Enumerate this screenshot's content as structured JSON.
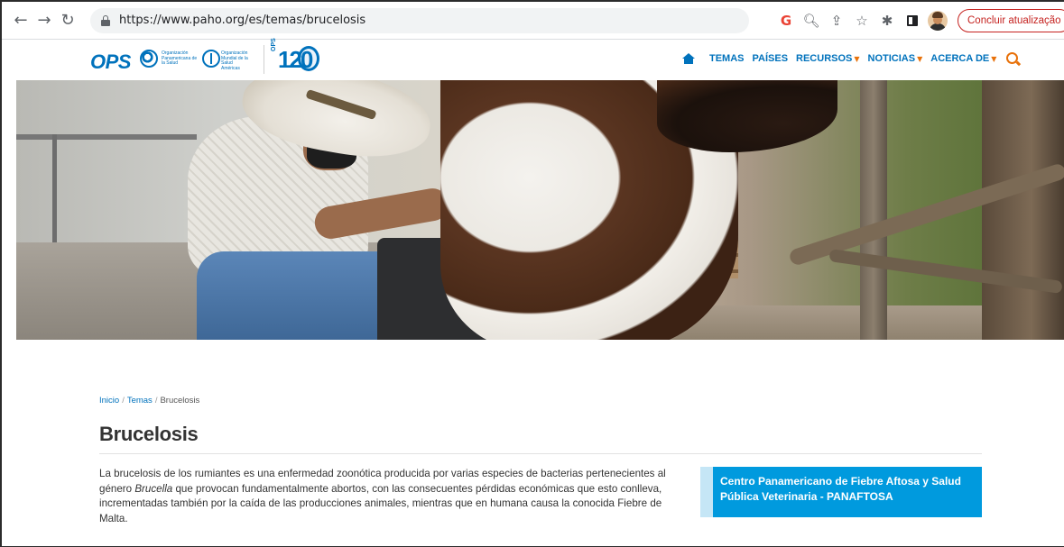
{
  "browser": {
    "url": "https://www.paho.org/es/temas/brucelosis",
    "update_label": "Concluir atualização",
    "icons": [
      "back-arrow-icon",
      "forward-arrow-icon",
      "reload-icon",
      "lock-icon",
      "google-lens-icon",
      "zoom-icon",
      "share-icon",
      "star-icon",
      "extensions-icon",
      "side-panel-icon",
      "profile-avatar",
      "menu-icon"
    ]
  },
  "site": {
    "logo_main": "OPS",
    "logo_ops_text": "Organización Panamericana de la Salud",
    "logo_who_text": "Organización Mundial de la Salud",
    "logo_who_subtext": "Américas",
    "logo_anniversary": "120",
    "logo_anniversary_tag": "OPS",
    "nav": {
      "home_icon": "home-icon",
      "items": [
        "TEMAS",
        "PAÍSES",
        "RECURSOS",
        "NOTICIAS",
        "ACERCA DE"
      ],
      "dropdown_chevron": "⌄",
      "search_icon": "search-icon"
    },
    "brand_color": "#0072bc",
    "accent_color": "#e8710a"
  },
  "breadcrumb": {
    "items": [
      "Inicio",
      "Temas",
      "Brucelosis"
    ],
    "separator": "/"
  },
  "page": {
    "title": "Brucelosis",
    "intro_before": "La brucelosis de los rumiantes es una enfermedad zoonótica producida por varias especies de bacterias pertenecientes al género ",
    "intro_italic": "Brucella",
    "intro_after": " que provocan fundamentalmente abortos, con las consecuentes pérdidas económicas que esto conlleva, incrementadas también por la caída de las producciones animales, mientras que en humana causa la conocida Fiebre de Malta."
  },
  "callout": {
    "label": "Centro Panamericano de Fiebre Aftosa y Salud Pública Veterinaria - PANAFTOSA",
    "color": "#009ade"
  }
}
